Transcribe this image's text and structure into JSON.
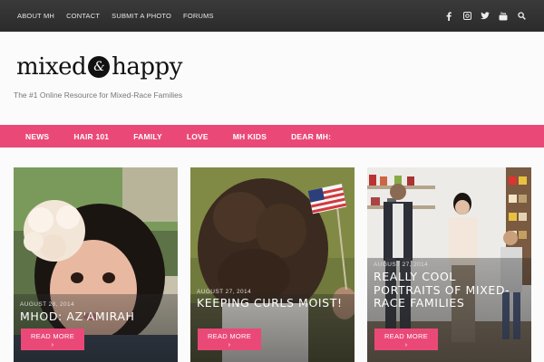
{
  "top_nav": [
    "ABOUT MH",
    "CONTACT",
    "SUBMIT A PHOTO",
    "FORUMS"
  ],
  "social_icons": [
    "facebook-icon",
    "instagram-icon",
    "twitter-icon",
    "youtube-icon",
    "search-icon"
  ],
  "logo": {
    "word1": "mixed",
    "amp": "&",
    "word2": "happy"
  },
  "tagline": "The #1 Online Resource for Mixed-Race Families",
  "main_nav": [
    "NEWS",
    "HAIR 101",
    "FAMILY",
    "LOVE",
    "MH KIDS",
    "DEAR MH:"
  ],
  "colors": {
    "accent": "#ea4978",
    "topbar": "#2f2f2f"
  },
  "posts": [
    {
      "date": "AUGUST 28, 2014",
      "title": "MHOD: AZ'AMIRAH",
      "more": "READ MORE",
      "more_arrow": "›"
    },
    {
      "date": "AUGUST 27, 2014",
      "title": "KEEPING CURLS MOIST!",
      "more": "READ MORE",
      "more_arrow": "›"
    },
    {
      "date": "AUGUST 27, 2014",
      "title": "REALLY COOL PORTRAITS OF MIXED-RACE FAMILIES",
      "more": "READ MORE",
      "more_arrow": "›"
    }
  ]
}
